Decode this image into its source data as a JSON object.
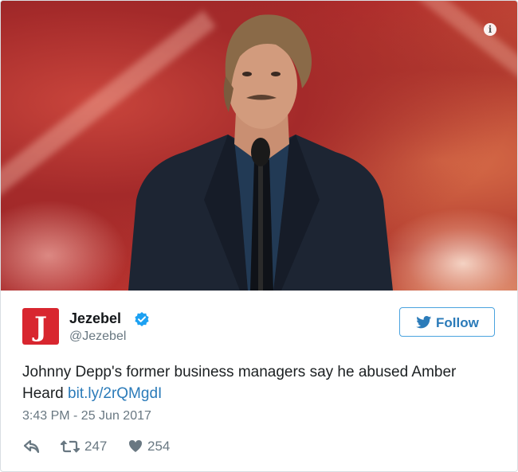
{
  "media": {
    "photo_subject": "man-at-microphone",
    "info_icon": "info-icon"
  },
  "author": {
    "logo_letter": "J",
    "name": "Jezebel",
    "handle": "@Jezebel",
    "verified": true,
    "brand_color": "#d8262f"
  },
  "follow": {
    "label": "Follow",
    "accent": "#2b7bb9"
  },
  "tweet": {
    "text": "Johnny Depp's former business managers say he abused Amber Heard ",
    "link": "bit.ly/2rQMgdI",
    "timestamp": "3:43 PM - 25 Jun 2017"
  },
  "actions": {
    "retweets": "247",
    "likes": "254",
    "icon_color": "#697882"
  }
}
